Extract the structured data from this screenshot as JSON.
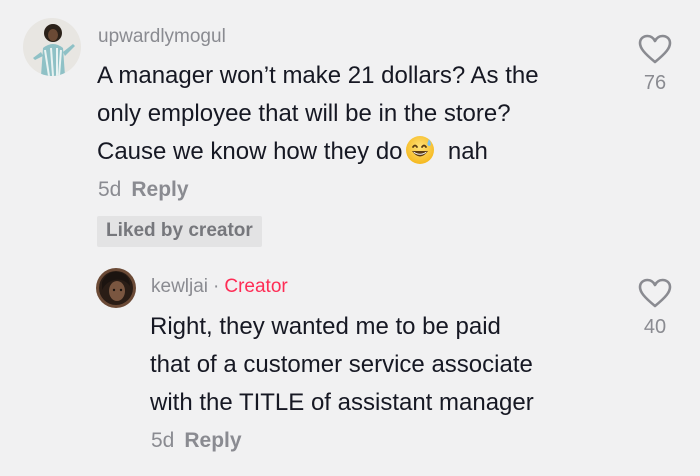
{
  "comments": [
    {
      "avatar_icon": "profile-photo",
      "username": "upwardlymogul",
      "lines": [
        "A manager won’t make 21 dollars? As the",
        "only employee that will be in the store?",
        "Cause we know how they do"
      ],
      "line_suffix": "nah",
      "emoji_icon": "grinning-sweat-emoji",
      "time": "5d",
      "reply_label": "Reply",
      "badge": "Liked by creator",
      "like_icon": "heart-outline-icon",
      "like_count": "76"
    },
    {
      "avatar_icon": "profile-photo",
      "username": "kewljai",
      "separator": "·",
      "creator_label": "Creator",
      "lines": [
        "Right, they wanted me to be paid",
        "that of a customer service associate",
        "with the TITLE of assistant manager"
      ],
      "time": "5d",
      "reply_label": "Reply",
      "like_icon": "heart-outline-icon",
      "like_count": "40"
    }
  ],
  "colors": {
    "background": "#f1f1f2",
    "text": "#161823",
    "muted": "#8a8b91",
    "creator": "#fe2c55",
    "badge_bg": "#e3e3e4"
  }
}
